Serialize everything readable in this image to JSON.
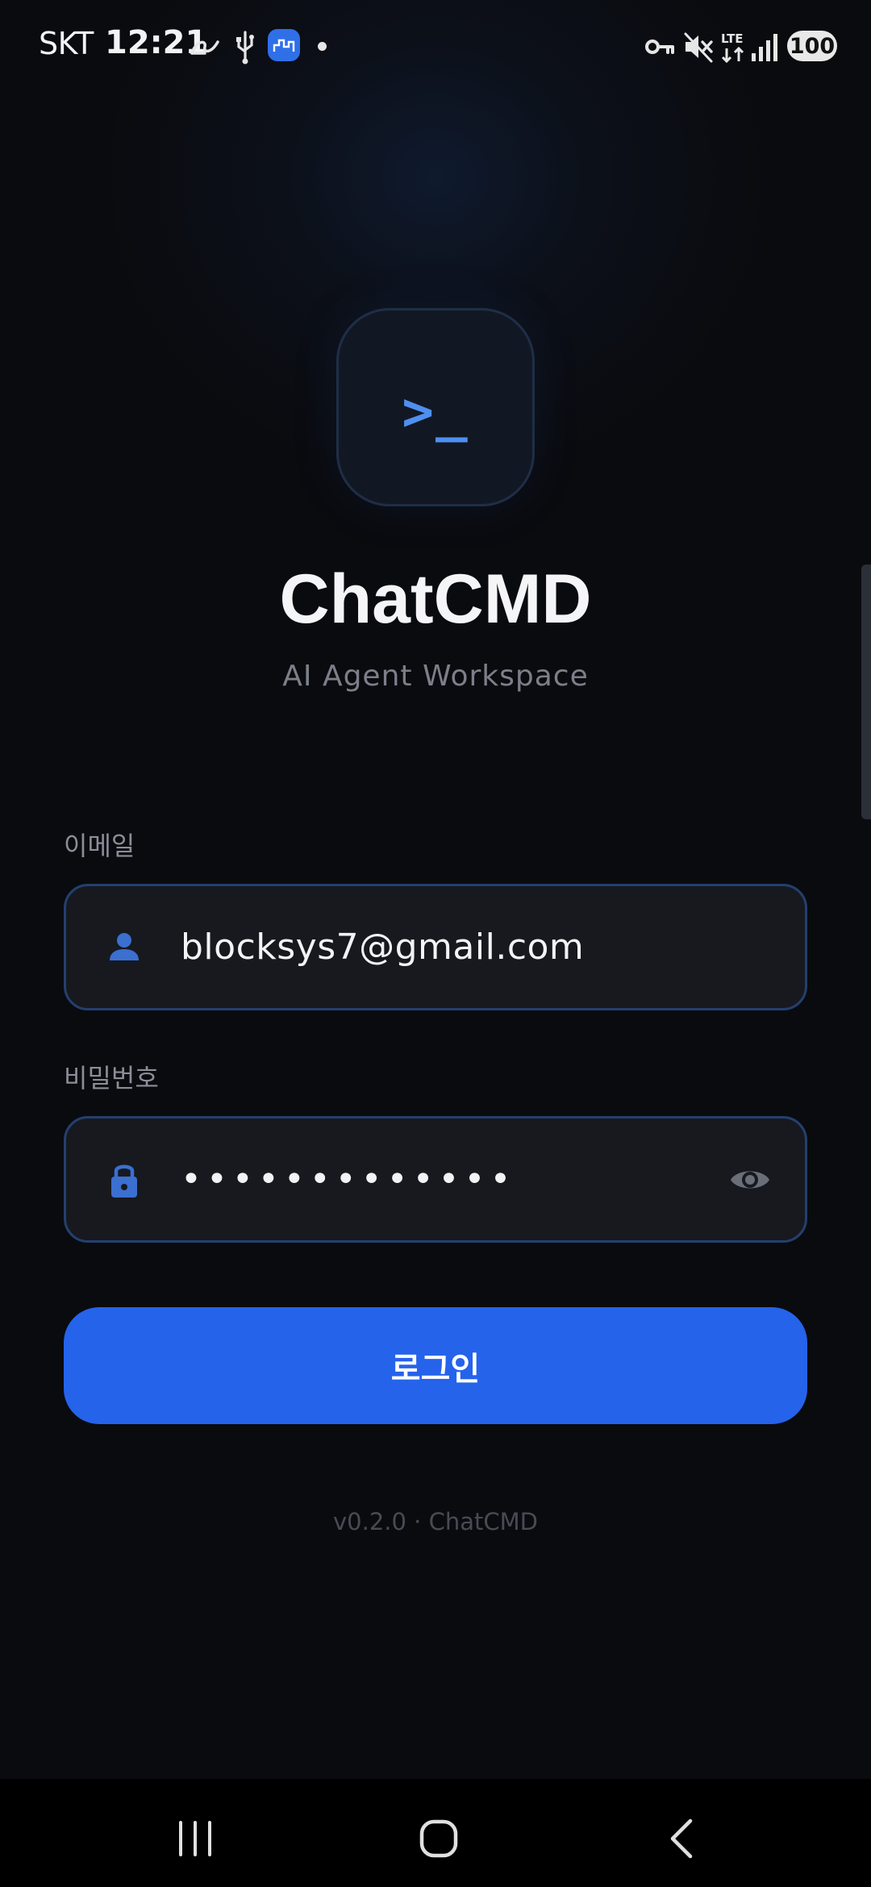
{
  "status_bar": {
    "carrier": "SKT",
    "time": "12:21",
    "battery": "100",
    "icons": [
      "link-icon",
      "usb-icon",
      "app-badge-icon",
      "notification-dot",
      "vpn-key-icon",
      "mute-icon",
      "lte-icon",
      "signal-icon",
      "battery-icon"
    ],
    "lte_label": "LTE"
  },
  "app": {
    "logo_prompt": ">_",
    "title": "ChatCMD",
    "subtitle": "AI Agent Workspace"
  },
  "form": {
    "email": {
      "label": "이메일",
      "value": "blocksys7@gmail.com",
      "icon": "person-icon"
    },
    "password": {
      "label": "비밀번호",
      "value": "•••••••••••••",
      "icon": "lock-icon",
      "toggle_icon": "eye-icon"
    },
    "login_label": "로그인"
  },
  "footer": {
    "version": "v0.2.0 · ChatCMD"
  },
  "nav_bar": {
    "buttons": [
      "recent-apps-icon",
      "home-icon",
      "back-icon"
    ]
  },
  "colors": {
    "background": "#0a0b0f",
    "accent": "#2563eb",
    "field_border": "#23406f",
    "field_icon": "#3b6fd0",
    "logo_prompt": "#4f8ff0"
  }
}
